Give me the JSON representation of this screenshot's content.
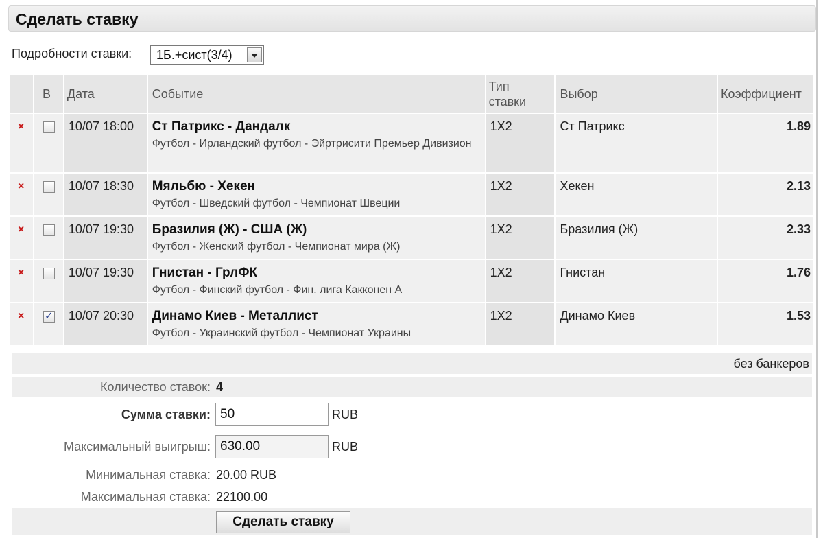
{
  "header": {
    "title": "Сделать ставку"
  },
  "details": {
    "label": "Подробности ставки:",
    "selected": "1Б.+сист(3/4)"
  },
  "table": {
    "headers": {
      "banker": "В",
      "date": "Дата",
      "event": "Событие",
      "bet_type_line1": "Тип",
      "bet_type_line2": "ставки",
      "selection": "Выбор",
      "odds": "Коэффициент"
    },
    "rows": [
      {
        "remove": "×",
        "checked": false,
        "date": "10/07 18:00",
        "event": "Ст Патрикс - Дандалк",
        "league": "Футбол - Ирландский футбол - Эйртрисити Премьер Дивизион",
        "type": "1X2",
        "selection": "Ст Патрикс",
        "odds": "1.89"
      },
      {
        "remove": "×",
        "checked": false,
        "date": "10/07 18:30",
        "event": "Мяльбю - Хекен",
        "league": "Футбол - Шведский футбол - Чемпионат Швеции",
        "type": "1X2",
        "selection": "Хекен",
        "odds": "2.13"
      },
      {
        "remove": "×",
        "checked": false,
        "date": "10/07 19:30",
        "event": "Бразилия (Ж) - США (Ж)",
        "league": "Футбол - Женский футбол - Чемпионат мира (Ж)",
        "type": "1X2",
        "selection": "Бразилия (Ж)",
        "odds": "2.33"
      },
      {
        "remove": "×",
        "checked": false,
        "date": "10/07 19:30",
        "event": "Гнистан - ГрлФК",
        "league": "Футбол - Финский футбол - Фин. лига Какконен А",
        "type": "1X2",
        "selection": "Гнистан",
        "odds": "1.76"
      },
      {
        "remove": "×",
        "checked": true,
        "date": "10/07 20:30",
        "event": "Динамо Киев - Металлист",
        "league": "Футбол - Украинский футбол - Чемпионат Украины",
        "type": "1X2",
        "selection": "Динамо Киев",
        "odds": "1.53"
      }
    ]
  },
  "summary": {
    "no_bankers": "без банкеров",
    "count_label": "Количество ставок:",
    "count_value": "4",
    "stake_label": "Сумма ставки:",
    "stake_value": "50",
    "currency": "RUB",
    "max_win_label": "Максимальный выигрыш:",
    "max_win_value": "630.00",
    "min_bet_label": "Минимальная ставка:",
    "min_bet_value": "20.00 RUB",
    "max_bet_label": "Максимальная ставка:",
    "max_bet_value": "22100.00",
    "submit_label": "Сделать ставку"
  },
  "colors": {
    "remove": "#c81a1a",
    "header_bg": "#e6e6e6",
    "row_bg": "#f0f0f0"
  },
  "icons": {
    "remove": "close-icon",
    "select": "chevron-down-icon",
    "checkbox": "checkbox-icon"
  }
}
